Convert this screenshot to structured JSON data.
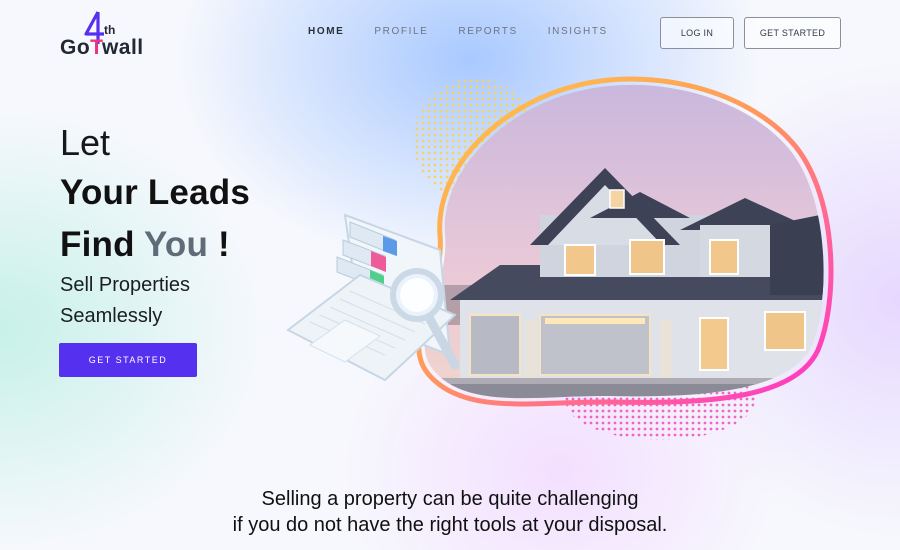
{
  "brand": {
    "logo_prefix": "Go",
    "logo_t": "T",
    "logo_suffix": "wall",
    "logo_sup": "th"
  },
  "nav": {
    "items": [
      {
        "label": "HOME",
        "active": true
      },
      {
        "label": "PROFILE",
        "active": false
      },
      {
        "label": "REPORTS",
        "active": false
      },
      {
        "label": "INSIGHTS",
        "active": false
      }
    ]
  },
  "header": {
    "login_label": "LOG IN",
    "get_started_label": "GET STARTED"
  },
  "hero": {
    "line1": "Let",
    "line2": "Your Leads",
    "line3_a": "Find",
    "line3_b": "You",
    "line3_c": "!",
    "sub1": "Sell Properties",
    "sub2": "Seamlessly",
    "cta_label": "GET STARTED"
  },
  "tagline": {
    "line1": "Selling a property can be quite challenging",
    "line2": "if you do not have the right tools at your disposal."
  },
  "colors": {
    "accent": "#5530ef",
    "logo_accent": "#e4377f",
    "blob_gradient_start": "#ff3ec8",
    "blob_gradient_end": "#ffc94a"
  },
  "icons": {
    "logo_mark": "digit-4-icon",
    "illustration": "laptop-magnifier-icon",
    "hero_image": "house-photo"
  }
}
